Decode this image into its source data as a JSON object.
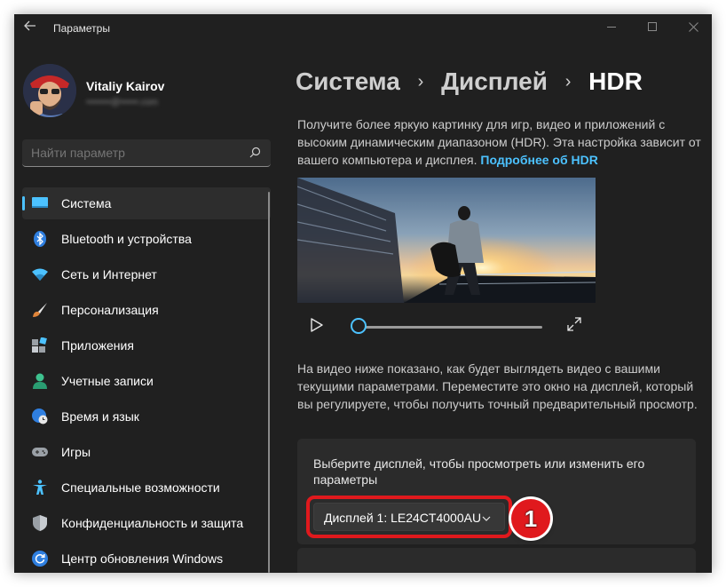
{
  "window": {
    "title": "Параметры",
    "back_icon": "back-arrow-icon",
    "controls": [
      "minimize-icon",
      "maximize-icon",
      "close-icon"
    ]
  },
  "profile": {
    "name": "Vitaliy Kairov",
    "email": "••••••••@••••••.com"
  },
  "search": {
    "placeholder": "Найти параметр",
    "icon": "search-icon"
  },
  "sidebar": {
    "items": [
      {
        "label": "Система",
        "icon": "system-icon",
        "active": true
      },
      {
        "label": "Bluetooth и устройства",
        "icon": "bluetooth-icon"
      },
      {
        "label": "Сеть и Интернет",
        "icon": "wifi-icon"
      },
      {
        "label": "Персонализация",
        "icon": "brush-icon"
      },
      {
        "label": "Приложения",
        "icon": "apps-icon"
      },
      {
        "label": "Учетные записи",
        "icon": "account-icon"
      },
      {
        "label": "Время и язык",
        "icon": "globe-clock-icon"
      },
      {
        "label": "Игры",
        "icon": "gamepad-icon"
      },
      {
        "label": "Специальные возможности",
        "icon": "accessibility-icon"
      },
      {
        "label": "Конфиденциальность и защита",
        "icon": "shield-icon"
      },
      {
        "label": "Центр обновления Windows",
        "icon": "update-icon"
      }
    ]
  },
  "breadcrumb": {
    "items": [
      "Система",
      "Дисплей",
      "HDR"
    ],
    "separator": "›"
  },
  "main": {
    "intro_text": "Получите более яркую картинку для игр, видео и приложений с высоким динамическим диапазоном (HDR). Эта настройка зависит от вашего компьютера и дисплея.",
    "intro_link": "Подробнее об HDR",
    "player": {
      "play_icon": "play-icon",
      "fullscreen_icon": "fullscreen-icon",
      "progress": 0
    },
    "description": "На видео ниже показано, как будет выглядеть видео с вашими текущими параметрами. Переместите это окно на дисплей, который вы регулируете, чтобы получить точный предварительный просмотр.",
    "display_card": {
      "text": "Выберите дисплей, чтобы просмотреть или изменить его параметры",
      "selected_display": "Дисплей 1: LE24CT4000AU",
      "annotation_badge": "1"
    }
  },
  "colors": {
    "accent": "#4cc2ff",
    "window_bg": "#202020",
    "card_bg": "#2b2b2b",
    "annotation_red": "#e0191d"
  }
}
